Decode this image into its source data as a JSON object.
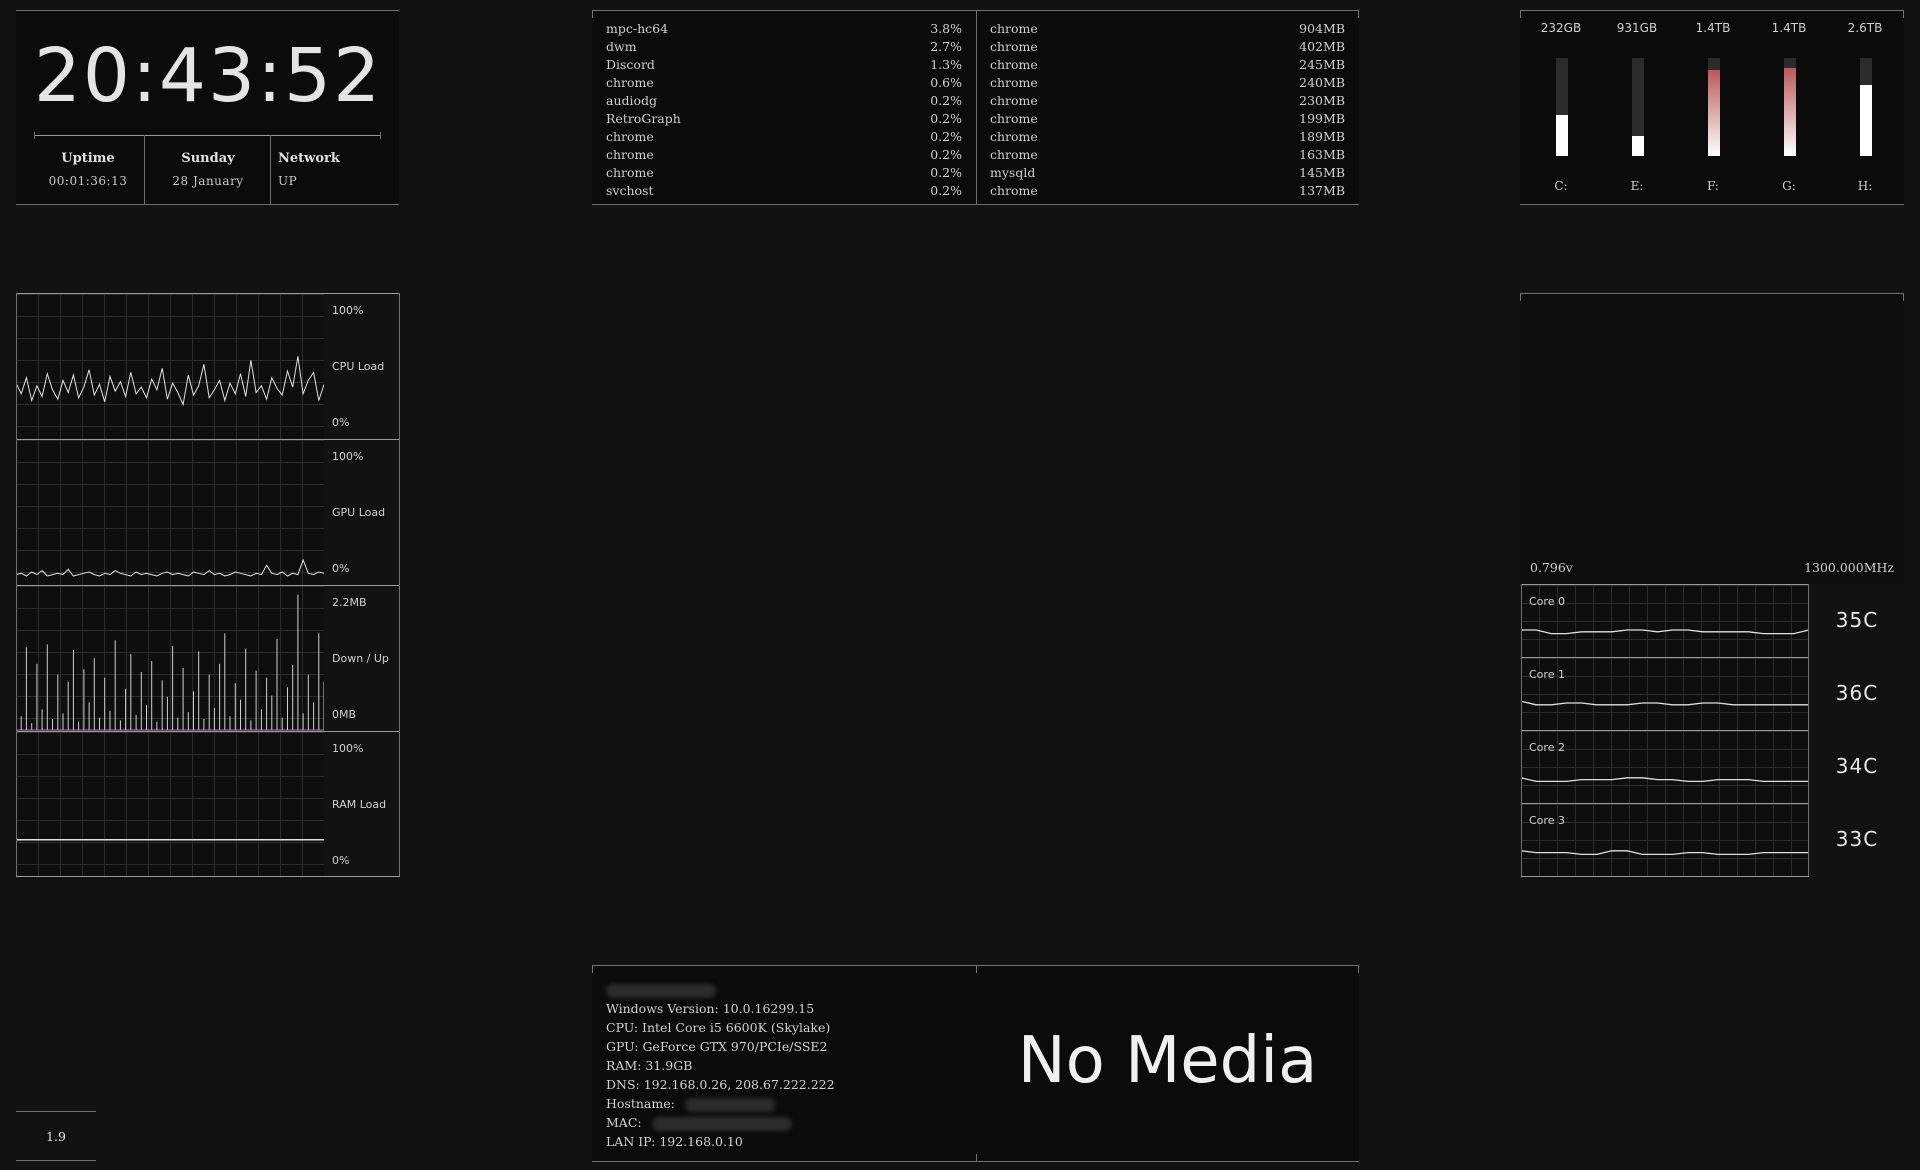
{
  "clock": {
    "time": "20:43:52",
    "columns": [
      {
        "header": "Uptime",
        "value": "00:01:36:13"
      },
      {
        "header": "Sunday",
        "value": "28 January"
      },
      {
        "header": "Network",
        "value": "UP"
      }
    ]
  },
  "processes": {
    "cpu": [
      {
        "name": "mpc-hc64",
        "value": "3.8%"
      },
      {
        "name": "dwm",
        "value": "2.7%"
      },
      {
        "name": "Discord",
        "value": "1.3%"
      },
      {
        "name": "chrome",
        "value": "0.6%"
      },
      {
        "name": "audiodg",
        "value": "0.2%"
      },
      {
        "name": "RetroGraph",
        "value": "0.2%"
      },
      {
        "name": "chrome",
        "value": "0.2%"
      },
      {
        "name": "chrome",
        "value": "0.2%"
      },
      {
        "name": "chrome",
        "value": "0.2%"
      },
      {
        "name": "svchost",
        "value": "0.2%"
      }
    ],
    "ram": [
      {
        "name": "chrome",
        "value": "904MB"
      },
      {
        "name": "chrome",
        "value": "402MB"
      },
      {
        "name": "chrome",
        "value": "245MB"
      },
      {
        "name": "chrome",
        "value": "240MB"
      },
      {
        "name": "chrome",
        "value": "230MB"
      },
      {
        "name": "chrome",
        "value": "199MB"
      },
      {
        "name": "chrome",
        "value": "189MB"
      },
      {
        "name": "chrome",
        "value": "163MB"
      },
      {
        "name": "mysqld",
        "value": "145MB"
      },
      {
        "name": "chrome",
        "value": "137MB"
      }
    ]
  },
  "drives": [
    {
      "capacity": "232GB",
      "letter": "C:",
      "used_fraction": 0.42,
      "color": "#ffffff"
    },
    {
      "capacity": "931GB",
      "letter": "E:",
      "used_fraction": 0.2,
      "color": "#ffffff"
    },
    {
      "capacity": "1.4TB",
      "letter": "F:",
      "used_fraction": 0.88,
      "color": "#b85a5a"
    },
    {
      "capacity": "1.4TB",
      "letter": "G:",
      "used_fraction": 0.9,
      "color": "#b85a5a"
    },
    {
      "capacity": "2.6TB",
      "letter": "H:",
      "used_fraction": 0.72,
      "color": "#ffffff"
    }
  ],
  "gpu_clock": {
    "voltage": "0.796v",
    "frequency": "1300.000MHz"
  },
  "graphs": [
    {
      "top": "100%",
      "mid": "CPU Load",
      "bottom": "0%",
      "values": [
        38,
        30,
        42,
        25,
        36,
        28,
        45,
        33,
        26,
        40,
        31,
        44,
        27,
        35,
        48,
        29,
        37,
        24,
        43,
        32,
        39,
        28,
        46,
        30,
        35,
        27,
        41,
        33,
        49,
        26,
        38,
        31,
        22,
        44,
        29,
        36,
        52,
        27,
        33,
        40,
        25,
        38,
        30,
        45,
        28,
        55,
        31,
        36,
        26,
        42,
        34,
        29,
        47,
        35,
        58,
        30,
        40,
        46,
        25,
        37
      ]
    },
    {
      "top": "100%",
      "mid": "GPU Load",
      "bottom": "0%",
      "values": [
        4,
        5,
        3,
        6,
        4,
        7,
        3,
        4,
        5,
        4,
        8,
        3,
        4,
        5,
        6,
        4,
        3,
        5,
        4,
        7,
        5,
        4,
        3,
        6,
        4,
        5,
        4,
        3,
        5,
        6,
        4,
        5,
        4,
        3,
        6,
        5,
        4,
        7,
        4,
        5,
        3,
        4,
        6,
        5,
        4,
        3,
        5,
        4,
        11,
        5,
        4,
        6,
        3,
        5,
        4,
        15,
        5,
        4,
        6,
        5
      ]
    },
    {
      "top": "2.2MB",
      "mid": "Down / Up",
      "bottom": "0MB",
      "values": [
        55,
        10,
        60,
        5,
        48,
        15,
        62,
        8,
        40,
        12,
        35,
        58,
        6,
        44,
        20,
        52,
        9,
        38,
        14,
        65,
        7,
        30,
        55,
        11,
        42,
        18,
        50,
        6,
        36,
        24,
        61,
        9,
        45,
        13,
        28,
        57,
        8,
        40,
        16,
        48,
        70,
        10,
        34,
        22,
        59,
        7,
        43,
        15,
        38,
        25,
        66,
        9,
        31,
        47,
        98,
        12,
        40,
        20,
        70,
        35
      ]
    },
    {
      "top": "100%",
      "mid": "RAM Load",
      "bottom": "0%",
      "values": [
        24,
        24,
        24,
        24,
        24,
        24,
        24,
        24,
        24,
        24,
        24,
        24,
        24,
        24,
        24,
        24,
        24,
        24,
        24,
        24,
        24,
        24,
        24,
        24,
        24,
        24,
        24,
        24,
        24,
        24,
        24,
        24,
        24,
        24,
        24,
        24,
        24,
        24,
        24,
        24,
        24,
        24,
        24,
        24,
        24,
        24,
        24,
        24,
        24,
        24,
        24,
        24,
        24,
        24,
        24,
        24,
        24,
        24,
        24,
        24
      ]
    }
  ],
  "cores": [
    {
      "label": "Core 0",
      "temp": "35C",
      "values": [
        35,
        35,
        33,
        33,
        34,
        34,
        34,
        35,
        35,
        34,
        35,
        35,
        34,
        34,
        34,
        34,
        33,
        33,
        33,
        35
      ]
    },
    {
      "label": "Core 1",
      "temp": "36C",
      "values": [
        36,
        34,
        34,
        35,
        35,
        34,
        34,
        34,
        35,
        35,
        34,
        34,
        35,
        35,
        34,
        34,
        34,
        34,
        34,
        34
      ]
    },
    {
      "label": "Core 2",
      "temp": "34C",
      "values": [
        34,
        32,
        32,
        32,
        33,
        33,
        33,
        34,
        34,
        33,
        33,
        32,
        32,
        33,
        33,
        33,
        32,
        32,
        32,
        32
      ]
    },
    {
      "label": "Core 3",
      "temp": "33C",
      "values": [
        34,
        33,
        33,
        33,
        32,
        32,
        34,
        34,
        32,
        32,
        32,
        33,
        33,
        32,
        32,
        32,
        33,
        33,
        33,
        33
      ]
    }
  ],
  "system": {
    "windows_version": "Windows Version: 10.0.16299.15",
    "cpu": "CPU: Intel Core i5 6600K (Skylake)",
    "gpu": "GPU: GeForce GTX 970/PCIe/SSE2",
    "ram": "RAM: 31.9GB",
    "dns": "DNS: 192.168.0.26, 208.67.222.222",
    "hostname": "Hostname:",
    "mac": "MAC:",
    "lan_ip": "LAN IP: 192.168.0.10"
  },
  "media": {
    "text": "No Media"
  },
  "version": "1.9"
}
